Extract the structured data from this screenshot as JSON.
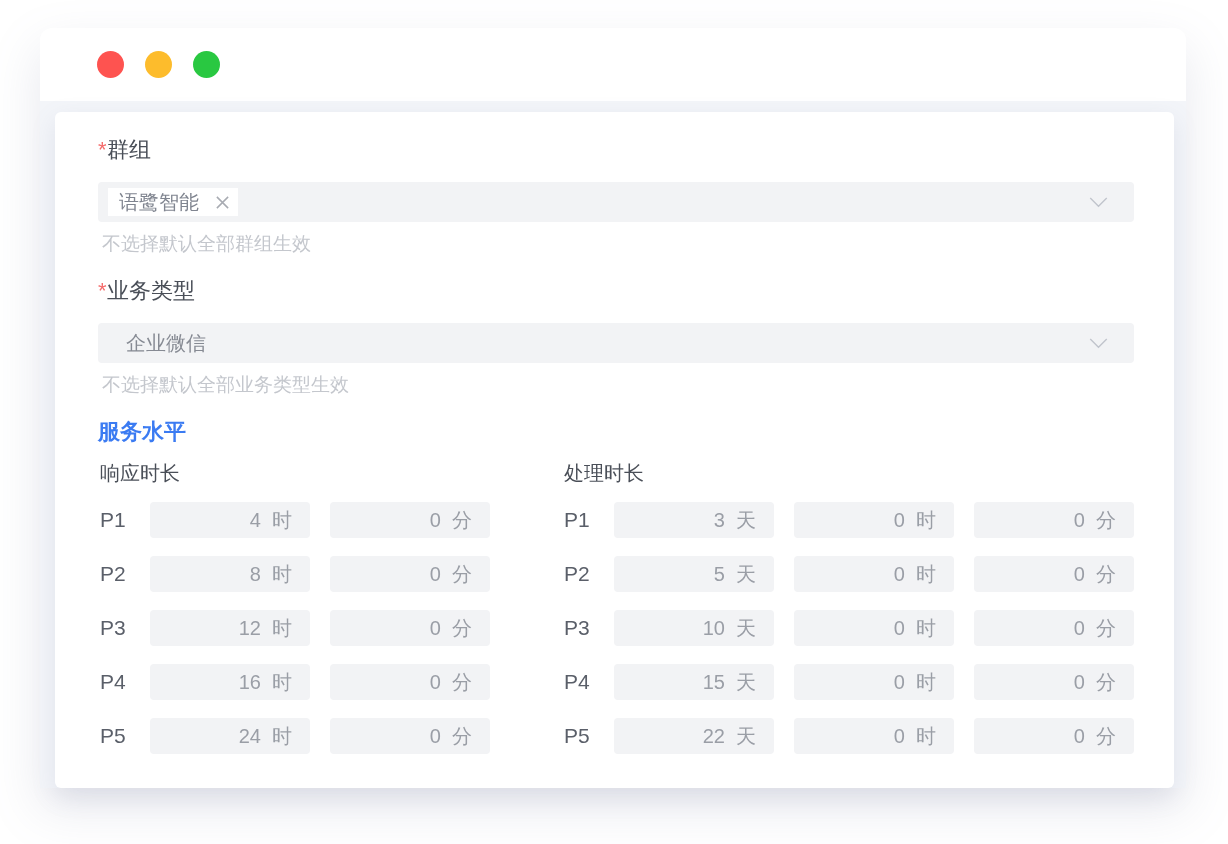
{
  "window": {
    "controls": [
      {
        "color": "#fe5350"
      },
      {
        "color": "#fdbc2c"
      },
      {
        "color": "#29c841"
      }
    ]
  },
  "group": {
    "required_mark": "*",
    "label": "群组",
    "tags": [
      {
        "label": "语鹭智能"
      }
    ],
    "hint": "不选择默认全部群组生效"
  },
  "business_type": {
    "required_mark": "*",
    "label": "业务类型",
    "value": "企业微信",
    "hint": "不选择默认全部业务类型生效"
  },
  "section_title": "服务水平",
  "response_time": {
    "title": "响应时长",
    "rows": [
      {
        "priority": "P1",
        "fields": [
          {
            "value": "4",
            "unit": "时"
          },
          {
            "value": "0",
            "unit": "分"
          }
        ]
      },
      {
        "priority": "P2",
        "fields": [
          {
            "value": "8",
            "unit": "时"
          },
          {
            "value": "0",
            "unit": "分"
          }
        ]
      },
      {
        "priority": "P3",
        "fields": [
          {
            "value": "12",
            "unit": "时"
          },
          {
            "value": "0",
            "unit": "分"
          }
        ]
      },
      {
        "priority": "P4",
        "fields": [
          {
            "value": "16",
            "unit": "时"
          },
          {
            "value": "0",
            "unit": "分"
          }
        ]
      },
      {
        "priority": "P5",
        "fields": [
          {
            "value": "24",
            "unit": "时"
          },
          {
            "value": "0",
            "unit": "分"
          }
        ]
      }
    ]
  },
  "handling_time": {
    "title": "处理时长",
    "rows": [
      {
        "priority": "P1",
        "fields": [
          {
            "value": "3",
            "unit": "天"
          },
          {
            "value": "0",
            "unit": "时"
          },
          {
            "value": "0",
            "unit": "分"
          }
        ]
      },
      {
        "priority": "P2",
        "fields": [
          {
            "value": "5",
            "unit": "天"
          },
          {
            "value": "0",
            "unit": "时"
          },
          {
            "value": "0",
            "unit": "分"
          }
        ]
      },
      {
        "priority": "P3",
        "fields": [
          {
            "value": "10",
            "unit": "天"
          },
          {
            "value": "0",
            "unit": "时"
          },
          {
            "value": "0",
            "unit": "分"
          }
        ]
      },
      {
        "priority": "P4",
        "fields": [
          {
            "value": "15",
            "unit": "天"
          },
          {
            "value": "0",
            "unit": "时"
          },
          {
            "value": "0",
            "unit": "分"
          }
        ]
      },
      {
        "priority": "P5",
        "fields": [
          {
            "value": "22",
            "unit": "天"
          },
          {
            "value": "0",
            "unit": "时"
          },
          {
            "value": "0",
            "unit": "分"
          }
        ]
      }
    ]
  }
}
